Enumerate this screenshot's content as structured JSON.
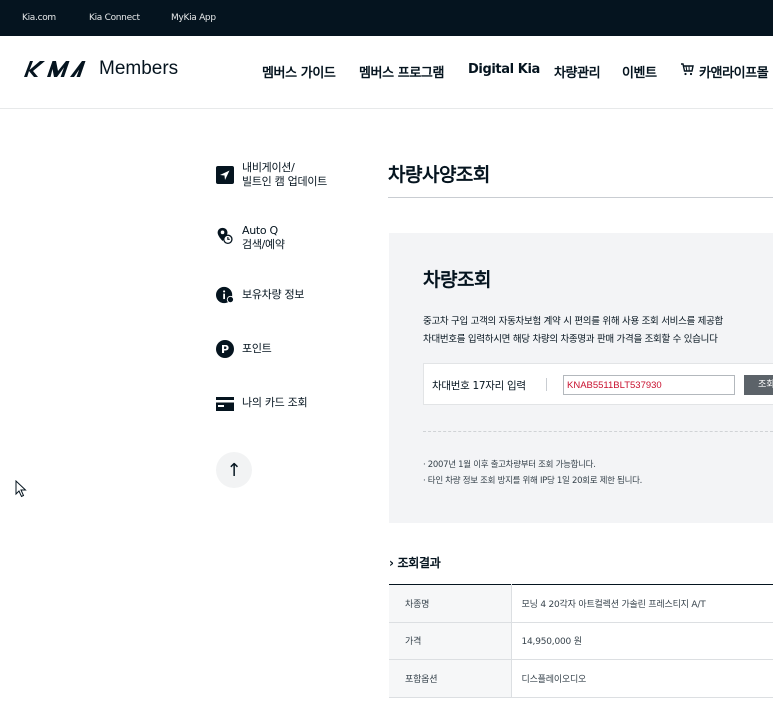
{
  "topbar": {
    "links": [
      "Kia.com",
      "Kia Connect",
      "MyKia App"
    ]
  },
  "header": {
    "logo_text": "Members",
    "nav": [
      "멤버스 가이드",
      "멤버스 프로그램",
      "Digital Kia",
      "차량관리",
      "이벤트",
      "카앤라이프몰"
    ]
  },
  "sidebar": {
    "items": [
      {
        "label": "내비게이션/\n빌트인 캠 업데이트",
        "icon": "navigation-icon"
      },
      {
        "label": "Auto Q\n검색/예약",
        "icon": "location-clock-icon"
      },
      {
        "label": "보유차량 정보",
        "icon": "info-icon"
      },
      {
        "label": "포인트",
        "icon": "point-icon"
      },
      {
        "label": "나의 카드 조회",
        "icon": "card-icon"
      }
    ],
    "up_label": "↑"
  },
  "main": {
    "page_title": "차량사양조회",
    "search": {
      "title": "차량조회",
      "desc_1": "중고차 구입 고객의 자동차보험 계약 시 편의를 위해 사용 조회 서비스를 제공합",
      "desc_2": "차대번호를 입력하시면 해당 차량의 차종명과 판매 가격을 조회할 수 있습니다",
      "input_label": "차대번호 17자리 입력",
      "vin_value": "KNAB5511BLT537930",
      "button_label": "조회",
      "notes": [
        "· 2007년 1월 이후 출고차량부터 조회 가능합니다.",
        "· 타인 차량 정보 조회 방지를 위해 IP당 1일 20회로 제한 됩니다."
      ]
    },
    "result": {
      "title": "조회결과",
      "rows": [
        {
          "label": "차종명",
          "value": "모닝 4 20각자 아트컬렉션 가솔린 프레스티지 A/T"
        },
        {
          "label": "가격",
          "value": "14,950,000 원"
        },
        {
          "label": "포함옵션",
          "value": "디스플레이오디오"
        }
      ]
    }
  }
}
